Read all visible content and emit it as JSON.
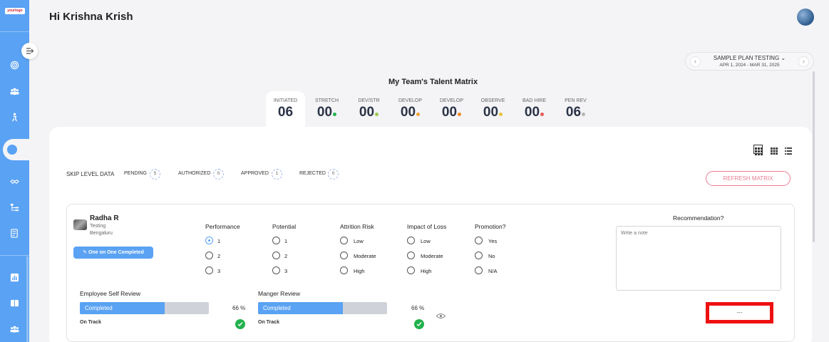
{
  "header": {
    "logo_text": "yourlogo",
    "greeting": "Hi Krishna Krish"
  },
  "plan": {
    "title": "SAMPLE PLAN TESTING",
    "dates": "APR 1, 2024 - MAR 31, 2025",
    "prev": "‹",
    "next": "›"
  },
  "matrix": {
    "title": "My Team's Talent Matrix",
    "tabs": [
      {
        "label": "INITIATED",
        "count": "06",
        "dot_color": ""
      },
      {
        "label": "STRETCH",
        "count": "00",
        "dot_color": "#22b14c"
      },
      {
        "label": "DEV/STR",
        "count": "00",
        "dot_color": "#9acb4a"
      },
      {
        "label": "DEVELOP",
        "count": "00",
        "dot_color": "#f2a43a"
      },
      {
        "label": "DEVELOP",
        "count": "00",
        "dot_color": "#f28a1e"
      },
      {
        "label": "OBSERVE",
        "count": "00",
        "dot_color": "#e9c13b"
      },
      {
        "label": "BAD HIRE",
        "count": "00",
        "dot_color": "#e65a5a"
      },
      {
        "label": "PEN REV",
        "count": "06",
        "dot_color": "#b5b5b5"
      }
    ]
  },
  "skip": {
    "label": "SKIP LEVEL DATA",
    "pending_label": "PENDING",
    "pending_count": "5",
    "authorized_label": "AUTHORIZED",
    "authorized_count": "0",
    "approved_label": "APPROVED",
    "approved_count": "1",
    "rejected_label": "REJECTED",
    "rejected_count": "0"
  },
  "refresh_label": "REFRESH MATRIX",
  "employee": {
    "name": "Radha R",
    "role": "Testing",
    "location": "Bengaluru",
    "one_on_one": "One on One Completed",
    "groups": {
      "performance": {
        "title": "Performance",
        "options": [
          "1",
          "2",
          "3"
        ]
      },
      "potential": {
        "title": "Potential",
        "options": [
          "1",
          "2",
          "3"
        ]
      },
      "attrition": {
        "title": "Attrition Risk",
        "options": [
          "Low",
          "Moderate",
          "High"
        ]
      },
      "impact": {
        "title": "Impact of Loss",
        "options": [
          "Low",
          "Moderate",
          "High"
        ]
      },
      "promotion": {
        "title": "Promotion?",
        "options": [
          "Yes",
          "No",
          "N/A"
        ]
      }
    },
    "recommendation_title": "Recommendation?",
    "note_placeholder": "Write a note",
    "self_review": {
      "title": "Employee Self Review",
      "status": "Completed",
      "percent": "66 %",
      "progress": 0.66,
      "track": "On Track"
    },
    "manager_review": {
      "title": "Manger Review",
      "status": "Completed",
      "percent": "66 %",
      "progress": 0.66,
      "track": "On Track"
    },
    "more_label": "---"
  },
  "colors": {
    "accent": "#5aa2f3",
    "pink": "#e97e93",
    "success": "#22b14c",
    "highlight": "#ee1111"
  }
}
